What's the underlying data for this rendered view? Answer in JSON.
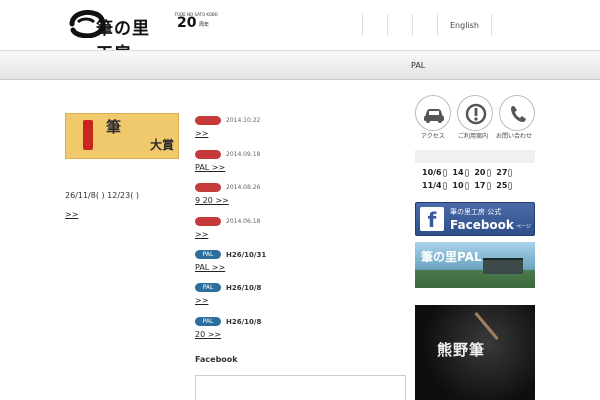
{
  "header": {
    "logo_text": "筆の里工房",
    "anniversary": {
      "small": "FUDE NO SATO KOBO",
      "number": "20",
      "unit": "周年",
      "subtitle": ""
    }
  },
  "top_nav": [
    {
      "label": ""
    },
    {
      "label": ""
    },
    {
      "label": ""
    },
    {
      "label": "English"
    }
  ],
  "main_nav": [
    {
      "label": ""
    },
    {
      "label": ""
    },
    {
      "label": ""
    },
    {
      "label": ""
    },
    {
      "label": ""
    },
    {
      "label": ""
    },
    {
      "label": "PAL"
    },
    {
      "label": ""
    }
  ],
  "left_column": {
    "section_title": "",
    "banner": {
      "vertical_text": "",
      "red_label": "",
      "bottom_text": "",
      "script_1": "筆",
      "script_2": "",
      "script_3": "大賞"
    },
    "caption": "",
    "dates": "26/11/8( ) 12/23( )",
    "more_link": ">>"
  },
  "news": {
    "section_title": "",
    "items": [
      {
        "tag": "",
        "tag_color": "red",
        "date": "2014.10.22",
        "title": ">>"
      },
      {
        "tag": "",
        "tag_color": "red",
        "date": "2014.09.18",
        "title": "PAL >>"
      },
      {
        "tag": "",
        "tag_color": "red",
        "date": "2014.08.26",
        "title": "9 20 >>"
      },
      {
        "tag": "",
        "tag_color": "red",
        "date": "2014.06.18",
        "title": ">>"
      },
      {
        "tag": "PAL",
        "tag_color": "blue",
        "date": "H26/10/31",
        "title": "PAL >>"
      },
      {
        "tag": "PAL",
        "tag_color": "blue",
        "date": "H26/10/8",
        "title": ">>"
      },
      {
        "tag": "PAL",
        "tag_color": "blue",
        "date": "H26/10/8",
        "title": "20 >>"
      }
    ],
    "facebook_title": "Facebook"
  },
  "right_column": {
    "icons": [
      {
        "name": "car-icon",
        "label": "アクセス"
      },
      {
        "name": "info-icon",
        "label": "ご利用案内"
      },
      {
        "name": "phone-icon",
        "label": "お問い合わせ"
      }
    ],
    "calendar": {
      "header": "",
      "row1": [
        {
          "date": "10/6",
          "wk": ""
        },
        {
          "date": "14",
          "wk": ""
        },
        {
          "date": "20",
          "wk": ""
        },
        {
          "date": "27",
          "wk": ""
        }
      ],
      "row2": [
        {
          "date": "11/4",
          "wk": ""
        },
        {
          "date": "10",
          "wk": ""
        },
        {
          "date": "17",
          "wk": ""
        },
        {
          "date": "25",
          "wk": ""
        }
      ]
    },
    "fb_banner": {
      "line1": "筆の里工房 公式",
      "line2": "Facebook",
      "line3": "ページ",
      "f": "f"
    },
    "pal_banner": {
      "line1": "筆の里PAL",
      "line2": "",
      "line3": ""
    },
    "photo_text": "熊野筆"
  },
  "colors": {
    "tag_red": "#c73a3a",
    "tag_blue": "#2c6f9e",
    "facebook_blue": "#3b5998"
  }
}
